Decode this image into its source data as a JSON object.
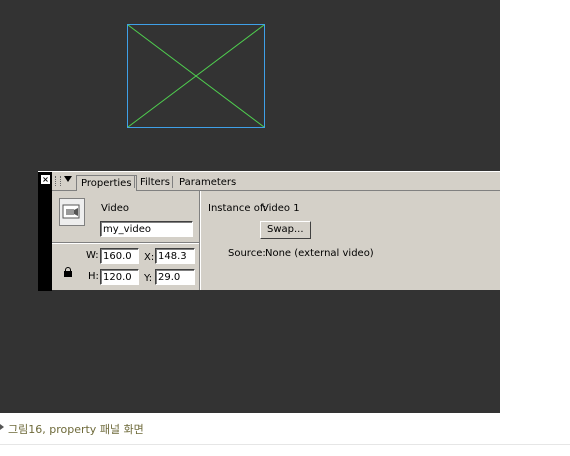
{
  "panel": {
    "tabs": [
      {
        "label": "Properties"
      },
      {
        "label": "Filters"
      },
      {
        "label": "Parameters"
      }
    ],
    "type_label": "Video",
    "instance_name": "my_video",
    "instance_of_label": "Instance of:",
    "instance_of_value": "Video 1",
    "swap_button": "Swap...",
    "width_label": "W:",
    "width_value": "160.0",
    "x_label": "X:",
    "x_value": "148.3",
    "height_label": "H:",
    "height_value": "120.0",
    "y_label": "Y:",
    "y_value": "29.0",
    "source_label": "Source:",
    "source_value": "None (external video)"
  },
  "caption": {
    "text": "그림16, property 패널 화면"
  },
  "colors": {
    "stage": "#333333",
    "placeholder_border": "#3fa0e8",
    "placeholder_cross": "#4fd04f"
  }
}
